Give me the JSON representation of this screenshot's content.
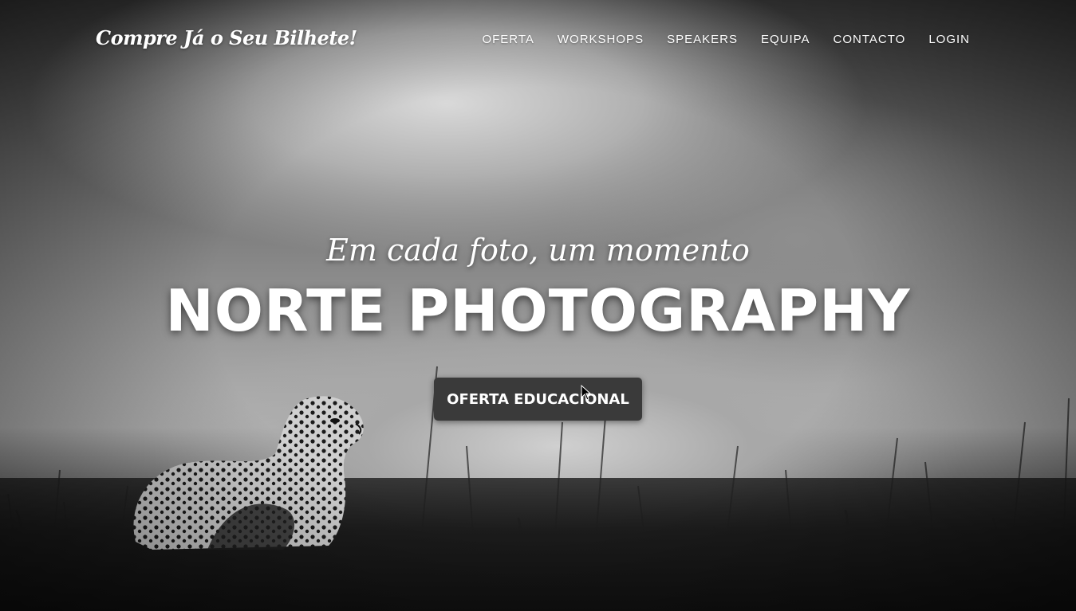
{
  "brand": {
    "title": "Compre Já o Seu Bilhete!"
  },
  "nav": {
    "items": [
      {
        "label": "OFERTA"
      },
      {
        "label": "WORKSHOPS"
      },
      {
        "label": "SPEAKERS"
      },
      {
        "label": "EQUIPA"
      },
      {
        "label": "CONTACTO"
      },
      {
        "label": "LOGIN"
      }
    ]
  },
  "hero": {
    "subheading": "Em cada foto, um momento",
    "heading": "NORTE PHOTOGRAPHY",
    "cta_label": "OFERTA EDUCACIONAL",
    "background_image": "cheetah-in-grass-black-and-white-photo"
  },
  "colors": {
    "text": "#ffffff",
    "cta_background": "#3a3a3a"
  }
}
